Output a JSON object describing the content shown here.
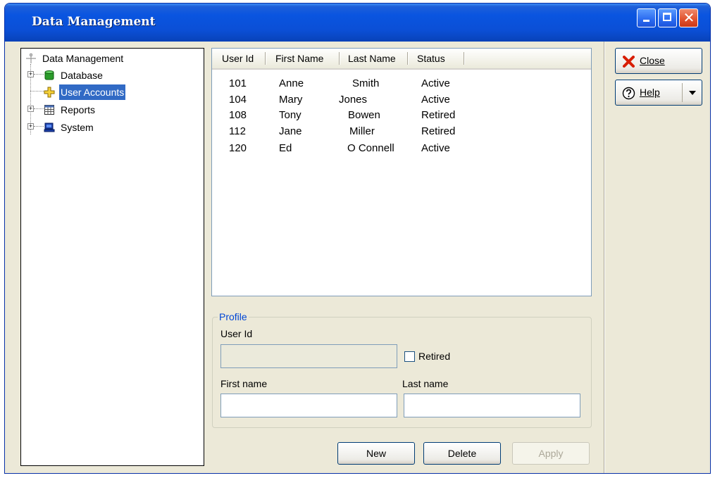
{
  "window": {
    "title": "Data Management"
  },
  "titlebar_buttons": {
    "minimize": "minimize-icon",
    "maximize": "maximize-icon",
    "close": "close-icon",
    "close_glyph": "✕"
  },
  "tree": {
    "root": {
      "label": "Data Management",
      "icon": "anchor-icon"
    },
    "items": [
      {
        "label": "Database",
        "icon": "database-icon",
        "expander": "+"
      },
      {
        "label": "User Accounts",
        "icon": "user-accounts-icon",
        "selected": true
      },
      {
        "label": "Reports",
        "icon": "reports-icon",
        "expander": "+"
      },
      {
        "label": "System",
        "icon": "computer-icon",
        "expander": "+"
      }
    ]
  },
  "list": {
    "columns": [
      "User Id",
      "First Name",
      "Last Name",
      "Status"
    ],
    "rows": [
      [
        "101",
        "Anne",
        "Smith",
        "Active"
      ],
      [
        "104",
        "Mary",
        "Jones",
        "Active"
      ],
      [
        "108",
        "Tony",
        "Bowen",
        "Retired"
      ],
      [
        "112",
        "Jane",
        "Miller",
        "Retired"
      ],
      [
        "120",
        "Ed",
        "O Connell",
        "Active"
      ]
    ]
  },
  "profile": {
    "legend": "Profile",
    "user_id_label": "User Id",
    "user_id_value": "",
    "retired_label": "Retired",
    "retired_checked": false,
    "first_name_label": "First name",
    "first_name_value": "",
    "last_name_label": "Last name",
    "last_name_value": ""
  },
  "buttons": {
    "new": "New",
    "delete": "Delete",
    "apply": "Apply"
  },
  "side": {
    "close_label": "Close",
    "close_icon": "red-x-icon",
    "help_label": "Help",
    "help_icon": "question-circle-icon",
    "help_dropdown": "chevron-down-icon"
  },
  "colors": {
    "title_bar": "#0A55E0",
    "selection": "#316AC5",
    "legend": "#0046D5",
    "window": "#ECE9D8"
  }
}
